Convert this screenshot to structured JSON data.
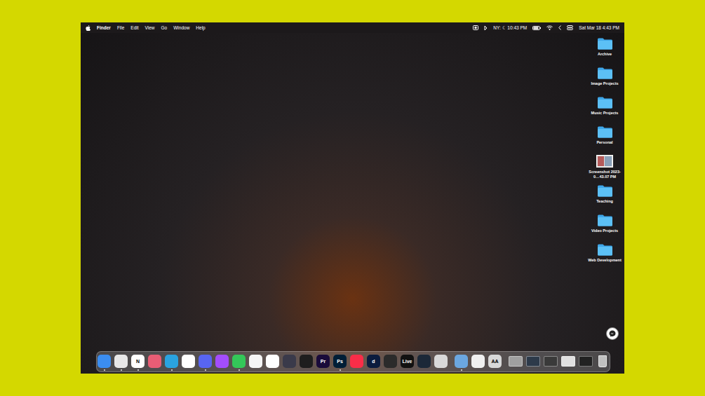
{
  "menu_bar": {
    "app": "Finder",
    "menus": [
      "File",
      "Edit",
      "View",
      "Go",
      "Window",
      "Help"
    ],
    "weather": "NY: ☾ 10:43 PM",
    "clock": "Sat Mar 18 4:43 PM"
  },
  "desktop_icons": [
    {
      "label": "Archive",
      "kind": "folder",
      "selected": false
    },
    {
      "label": "Image Projects",
      "kind": "folder",
      "selected": false
    },
    {
      "label": "Music Projects",
      "kind": "folder",
      "selected": false
    },
    {
      "label": "Personal",
      "kind": "folder",
      "selected": false
    },
    {
      "label": "Screenshot 2023-0…43.07 PM",
      "kind": "image",
      "selected": false
    },
    {
      "label": "Teaching",
      "kind": "folder",
      "selected": false
    },
    {
      "label": "Video Projects",
      "kind": "folder",
      "selected": false
    },
    {
      "label": "Web Development",
      "kind": "folder",
      "selected": false
    }
  ],
  "dock": {
    "items": [
      {
        "kind": "app",
        "color": "#3b8df0",
        "running": true
      },
      {
        "kind": "app",
        "color": "#e8e8e8",
        "running": true
      },
      {
        "kind": "app",
        "color": "#ffffff",
        "label": "N",
        "running": true
      },
      {
        "kind": "app",
        "color": "#e85d75",
        "running": false
      },
      {
        "kind": "app",
        "color": "#2aa3e0",
        "running": true
      },
      {
        "kind": "app",
        "color": "#ffffff",
        "running": false
      },
      {
        "kind": "app",
        "color": "#5865f2",
        "running": true
      },
      {
        "kind": "app",
        "color": "#a34dfc",
        "running": false
      },
      {
        "kind": "app",
        "color": "#34c759",
        "running": true
      },
      {
        "kind": "app",
        "color": "#f5f5f5",
        "running": false
      },
      {
        "kind": "app",
        "color": "#ffffff",
        "running": false
      },
      {
        "kind": "app",
        "color": "#3a3a4a",
        "running": false
      },
      {
        "kind": "app",
        "color": "#1e1e1e",
        "running": false
      },
      {
        "kind": "app",
        "color": "#1a0b3a",
        "label": "Pr",
        "running": false
      },
      {
        "kind": "app",
        "color": "#001e36",
        "label": "Ps",
        "running": true
      },
      {
        "kind": "app",
        "color": "#fa2d48",
        "running": false
      },
      {
        "kind": "app",
        "color": "#0b1c3e",
        "label": "d",
        "running": false
      },
      {
        "kind": "app",
        "color": "#2b2b2b",
        "running": false
      },
      {
        "kind": "app",
        "color": "#111111",
        "label": "Live",
        "running": false
      },
      {
        "kind": "app",
        "color": "#1b2838",
        "running": false
      },
      {
        "kind": "app",
        "color": "#d9d9d9",
        "running": false
      },
      {
        "kind": "separator"
      },
      {
        "kind": "app",
        "color": "#6ba7e0",
        "running": true
      },
      {
        "kind": "app",
        "color": "#f0f0f0",
        "running": false
      },
      {
        "kind": "app",
        "color": "#d8d8d8",
        "label": "AA",
        "running": false
      },
      {
        "kind": "separator"
      },
      {
        "kind": "window",
        "color": "#a0a0a0"
      },
      {
        "kind": "window",
        "color": "#2d3a4a"
      },
      {
        "kind": "window",
        "color": "#3a3a3a"
      },
      {
        "kind": "window",
        "color": "#e0e0e0"
      },
      {
        "kind": "window",
        "color": "#222222"
      },
      {
        "kind": "trash",
        "color": "#c0c0c0"
      }
    ]
  }
}
